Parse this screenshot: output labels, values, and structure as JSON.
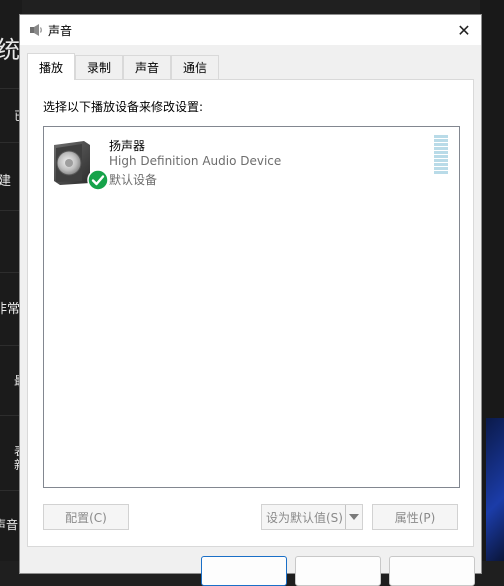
{
  "background": {
    "text_items": [
      "统",
      "已",
      "建",
      "非常规",
      "最",
      "表",
      "新",
      "声音"
    ]
  },
  "window": {
    "title": "声音",
    "close_glyph": "✕"
  },
  "tabs": [
    {
      "label": "播放",
      "active": true
    },
    {
      "label": "录制",
      "active": false
    },
    {
      "label": "声音",
      "active": false
    },
    {
      "label": "通信",
      "active": false
    }
  ],
  "playback": {
    "instruction": "选择以下播放设备来修改设置:",
    "devices": [
      {
        "name": "扬声器",
        "description": "High Definition Audio Device",
        "status": "默认设备"
      }
    ]
  },
  "buttons": {
    "configure": "配置(C)",
    "set_default": "设为默认值(S)",
    "properties": "属性(P)"
  },
  "colors": {
    "accent": "#1a6fc7",
    "check_green": "#16a34a",
    "meter": "#b9dbe8"
  }
}
